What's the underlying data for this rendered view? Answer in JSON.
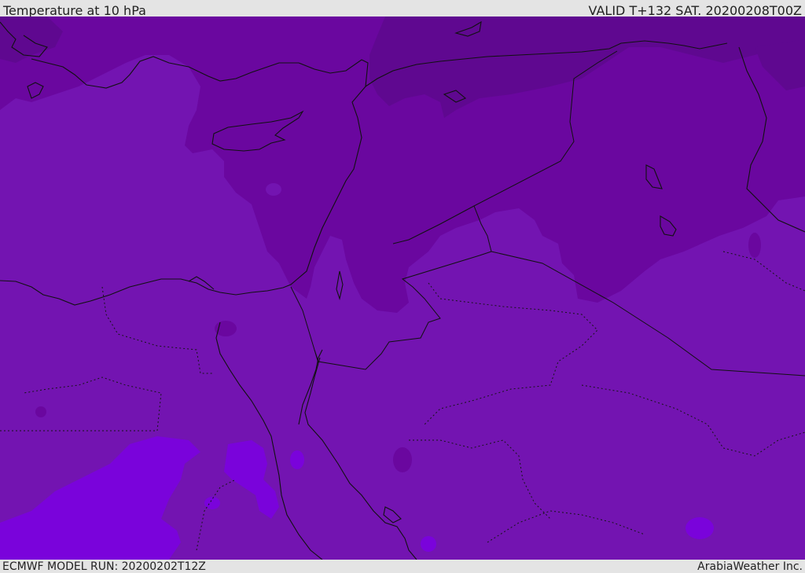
{
  "header": {
    "title": "Temperature at 10 hPa",
    "valid": "VALID T+132 SAT. 20200208T00Z"
  },
  "footer": {
    "model_run": "ECMWF MODEL RUN: 20200202T12Z",
    "credit": "ArabiaWeather Inc."
  },
  "colors": {
    "base_field": "#7314b1",
    "cold_field": "#6a079f",
    "colder_field": "#5f0890",
    "warm_field": "#7a03db",
    "coast_line": "#111111",
    "border_line": "#111111",
    "bar_background": "#e4e4e4"
  }
}
